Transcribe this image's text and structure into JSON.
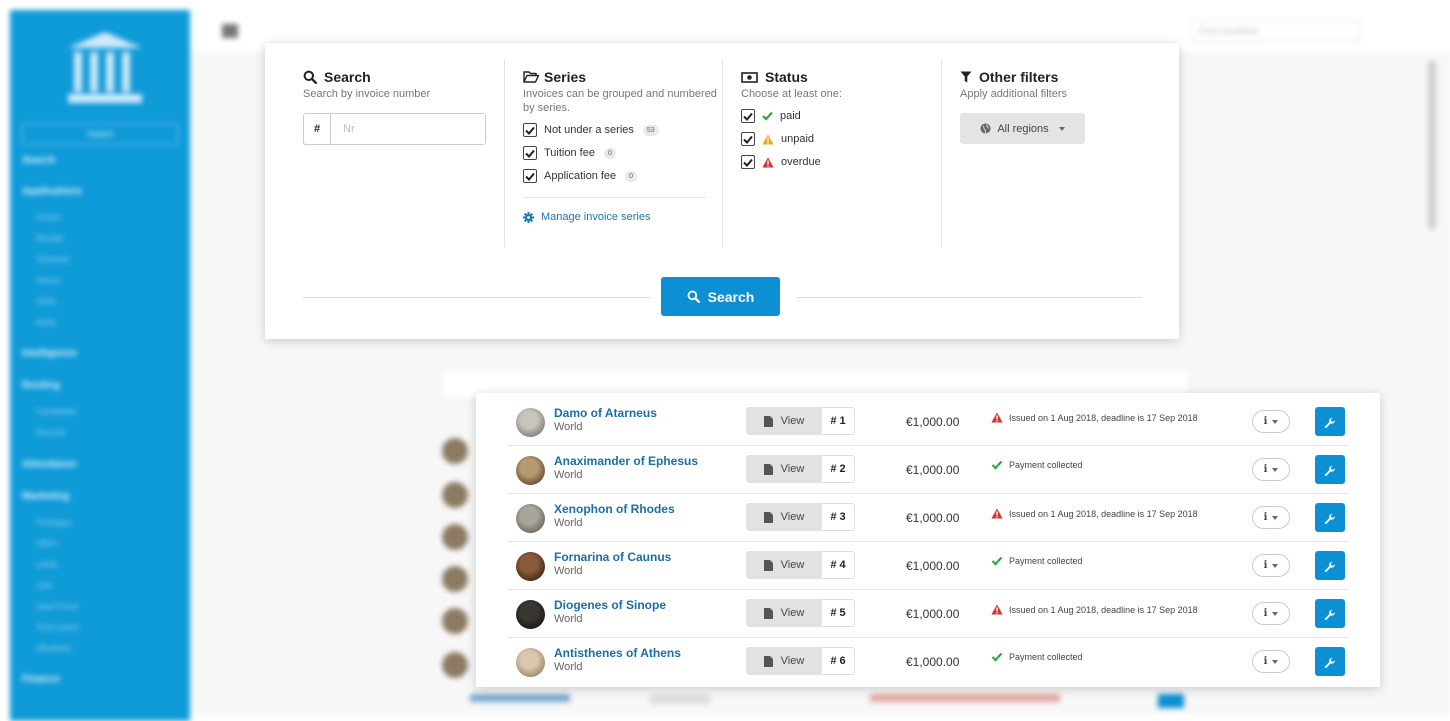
{
  "background": {
    "sidebar_button": "Switch",
    "sidebar_items": [
      "Search",
      "Applications",
      "Intelligence",
      "Routing",
      "Attendance",
      "Marketing",
      "Finance"
    ],
    "sidebar_subitems": [
      "Invoice",
      "Receipt",
      "Schedule",
      "Search",
      "Tasks",
      "Rules",
      "Candidates",
      "Records",
      "Packages",
      "Offers",
      "Leads",
      "Lists",
      "Input Forms",
      "Print Letters",
      "eBooklets"
    ],
    "search_placeholder": "Find candidate",
    "colors": {
      "sidebar": "#0f9ad8"
    }
  },
  "filters": {
    "search": {
      "title": "Search",
      "subtitle": "Search by invoice number",
      "prefix": "#",
      "placeholder": "Nr"
    },
    "series": {
      "title": "Series",
      "subtitle": "Invoices can be grouped and numbered by series.",
      "options": [
        {
          "label": "Not under a series",
          "count": "53",
          "checked": true
        },
        {
          "label": "Tuition fee",
          "count": "0",
          "checked": true
        },
        {
          "label": "Application fee",
          "count": "0",
          "checked": true
        }
      ],
      "manage_link": "Manage invoice series"
    },
    "status": {
      "title": "Status",
      "subtitle": "Choose at least one:",
      "options": [
        {
          "label": "paid",
          "icon": "check-icon",
          "color": "#2eaa3a",
          "checked": true
        },
        {
          "label": "unpaid",
          "icon": "warning-icon",
          "color": "#f0a81c",
          "checked": true
        },
        {
          "label": "overdue",
          "icon": "warning-icon",
          "color": "#d9302c",
          "checked": true
        }
      ]
    },
    "other": {
      "title": "Other filters",
      "subtitle": "Apply additional filters",
      "region_button": "All regions"
    },
    "search_button": "Search",
    "colors": {
      "primary": "#0d8fd4"
    }
  },
  "invoices": [
    {
      "name": "Damo of Atarneus",
      "region": "World",
      "view": "View",
      "number": "# 1",
      "amount": "€1,000.00",
      "status": "Issued on 1 Aug 2018, deadline is 17 Sep 2018",
      "status_type": "overdue"
    },
    {
      "name": "Anaximander of Ephesus",
      "region": "World",
      "view": "View",
      "number": "# 2",
      "amount": "€1,000.00",
      "status": "Payment collected",
      "status_type": "paid"
    },
    {
      "name": "Xenophon of Rhodes",
      "region": "World",
      "view": "View",
      "number": "# 3",
      "amount": "€1,000.00",
      "status": "Issued on 1 Aug 2018, deadline is 17 Sep 2018",
      "status_type": "overdue"
    },
    {
      "name": "Fornarina of Caunus",
      "region": "World",
      "view": "View",
      "number": "# 4",
      "amount": "€1,000.00",
      "status": "Payment collected",
      "status_type": "paid"
    },
    {
      "name": "Diogenes of Sinope",
      "region": "World",
      "view": "View",
      "number": "# 5",
      "amount": "€1,000.00",
      "status": "Issued on 1 Aug 2018, deadline is 17 Sep 2018",
      "status_type": "overdue"
    },
    {
      "name": "Antisthenes of Athens",
      "region": "World",
      "view": "View",
      "number": "# 6",
      "amount": "€1,000.00",
      "status": "Payment collected",
      "status_type": "paid"
    }
  ],
  "row_info_label": "i"
}
